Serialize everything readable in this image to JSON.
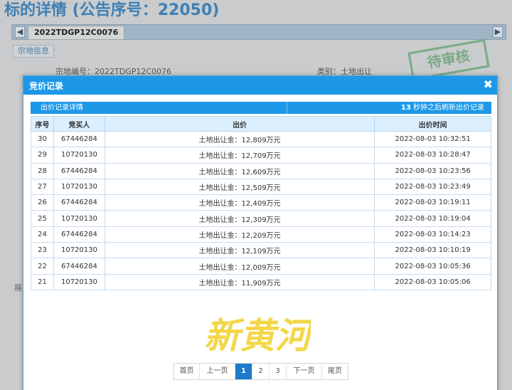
{
  "background": {
    "page_title": "标的详情 (公告序号：22050)",
    "tab_label": "2022TDGP12C0076",
    "subtab_label": "宗地信息",
    "field_left": "宗地编号：2022TDGP12C0076",
    "field_right": "类别：土地出让",
    "stamp_text": "待审核",
    "side_char": "展"
  },
  "modal": {
    "title": "竞价记录",
    "close_glyph": "✖",
    "info_left": "出价记录详情",
    "countdown_seconds": "13",
    "countdown_suffix": " 秒钟之后刷新出价记录",
    "columns": [
      "序号",
      "竞买人",
      "出价",
      "出价时间"
    ],
    "rows": [
      {
        "no": "30",
        "bidder": "67446284",
        "price": "土地出让金：12,809万元",
        "time": "2022-08-03 10:32:51"
      },
      {
        "no": "29",
        "bidder": "10720130",
        "price": "土地出让金：12,709万元",
        "time": "2022-08-03 10:28:47"
      },
      {
        "no": "28",
        "bidder": "67446284",
        "price": "土地出让金：12,609万元",
        "time": "2022-08-03 10:23:56"
      },
      {
        "no": "27",
        "bidder": "10720130",
        "price": "土地出让金：12,509万元",
        "time": "2022-08-03 10:23:49"
      },
      {
        "no": "26",
        "bidder": "67446284",
        "price": "土地出让金：12,409万元",
        "time": "2022-08-03 10:19:11"
      },
      {
        "no": "25",
        "bidder": "10720130",
        "price": "土地出让金：12,309万元",
        "time": "2022-08-03 10:19:04"
      },
      {
        "no": "24",
        "bidder": "67446284",
        "price": "土地出让金：12,209万元",
        "time": "2022-08-03 10:14:23"
      },
      {
        "no": "23",
        "bidder": "10720130",
        "price": "土地出让金：12,109万元",
        "time": "2022-08-03 10:10:19"
      },
      {
        "no": "22",
        "bidder": "67446284",
        "price": "土地出让金：12,009万元",
        "time": "2022-08-03 10:05:36"
      },
      {
        "no": "21",
        "bidder": "10720130",
        "price": "土地出让金：11,909万元",
        "time": "2022-08-03 10:05:06"
      }
    ],
    "watermark_text": "新黄河",
    "pager": {
      "first": "首页",
      "prev": "上一页",
      "pages": [
        "1",
        "2",
        "3"
      ],
      "active_page": "1",
      "next": "下一页",
      "last": "尾页"
    }
  },
  "colors": {
    "accent": "#1d98e8",
    "header_row": "#dcefff",
    "watermark": "#f2d43a"
  }
}
